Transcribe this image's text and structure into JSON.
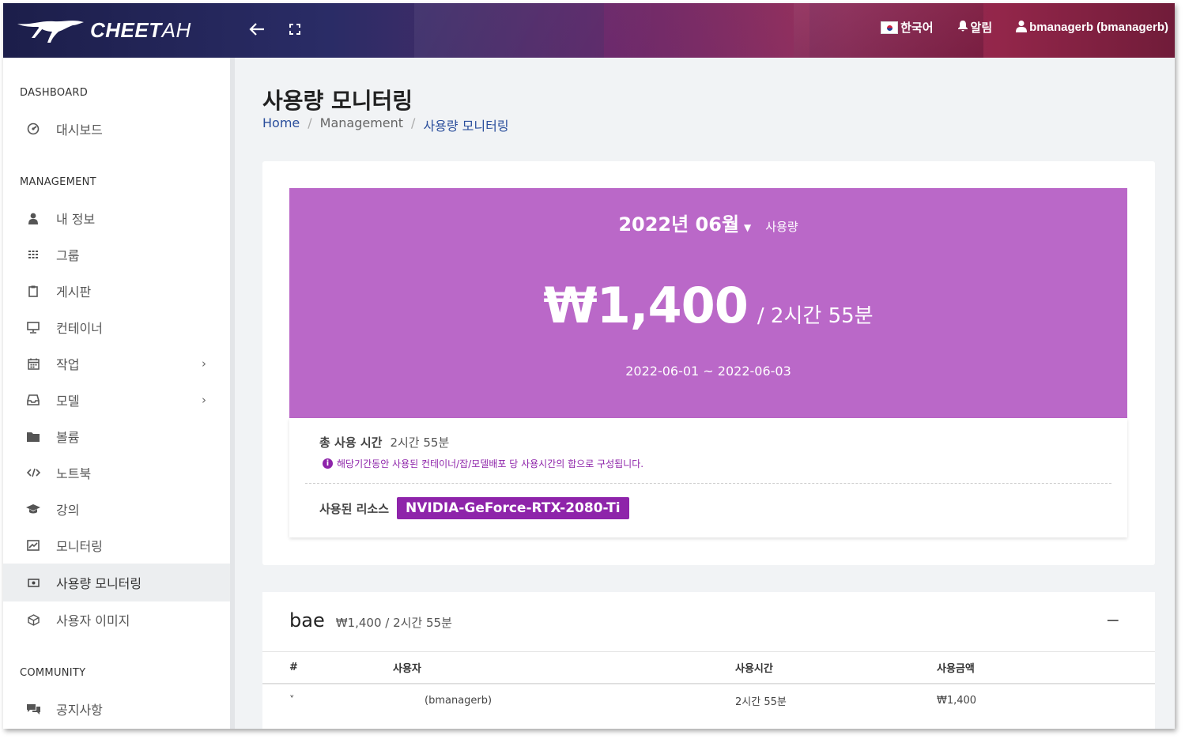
{
  "header": {
    "logo_text_bold": "CHEET",
    "logo_text_thin": "AH",
    "back_icon": "arrow-left-icon",
    "fullscreen_icon": "expand-icon",
    "language_label": "한국어",
    "alarm_label": "알림",
    "user_label": "bmanagerb (bmanagerb)"
  },
  "sidebar": {
    "sections": [
      {
        "title": "DASHBOARD"
      },
      {
        "title": "MANAGEMENT"
      },
      {
        "title": "COMMUNITY"
      }
    ],
    "items": [
      {
        "label": "대시보드",
        "icon": "dashboard-icon"
      },
      {
        "label": "내 정보",
        "icon": "user-icon"
      },
      {
        "label": "그룹",
        "icon": "grid-icon"
      },
      {
        "label": "게시판",
        "icon": "clipboard-icon"
      },
      {
        "label": "컨테이너",
        "icon": "monitor-icon"
      },
      {
        "label": "작업",
        "icon": "calendar-icon",
        "expandable": true
      },
      {
        "label": "모델",
        "icon": "inbox-icon",
        "expandable": true
      },
      {
        "label": "볼륨",
        "icon": "folder-icon"
      },
      {
        "label": "노트북",
        "icon": "code-icon"
      },
      {
        "label": "강의",
        "icon": "graduation-cap-icon"
      },
      {
        "label": "모니터링",
        "icon": "chart-icon"
      },
      {
        "label": "사용량 모니터링",
        "icon": "money-icon",
        "active": true
      },
      {
        "label": "사용자 이미지",
        "icon": "cube-icon"
      },
      {
        "label": "공지사항",
        "icon": "comments-icon"
      }
    ]
  },
  "page": {
    "title": "사용량 모니터링",
    "breadcrumb": [
      "Home",
      "Management",
      "사용량 모니터링"
    ]
  },
  "summary": {
    "month": "2022년 06월",
    "month_suffix": "사용량",
    "amount": "₩1,400",
    "duration": "/ 2시간 55분",
    "range": "2022-06-01 ~ 2022-06-03",
    "total_label": "총 사용 시간",
    "total_value": "2시간 55분",
    "note": "해당기간동안 사용된 컨테이너/잡/모델배포 당 사용시간의 합으로 구성됩니다.",
    "resource_label": "사용된 리소스",
    "resource_value": "NVIDIA-GeForce-RTX-2080-Ti",
    "colors": {
      "hero": "#ba68c8",
      "accent": "#8e24aa"
    }
  },
  "group": {
    "name": "bae",
    "summary": "₩1,400 / 2시간 55분",
    "collapse_label": "−",
    "columns": [
      "#",
      "사용자",
      "사용시간",
      "사용금액"
    ],
    "rows": [
      {
        "expand": "˅",
        "user": "(bmanagerb)",
        "time": "2시간 55분",
        "amount": "₩1,400"
      }
    ]
  }
}
